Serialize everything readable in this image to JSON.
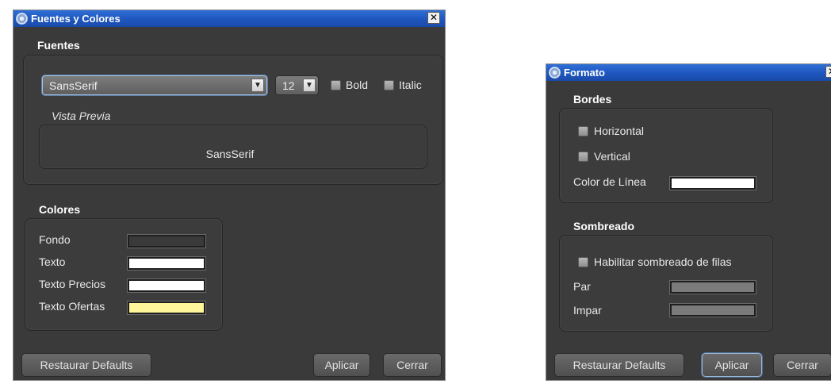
{
  "left_window": {
    "title": "Fuentes y Colores",
    "close_glyph": "✕",
    "fuentes": {
      "label": "Fuentes",
      "font_select": "SansSerif",
      "size_select": "12",
      "bold_label": "Bold",
      "italic_label": "Italic",
      "preview_label": "Vista Previa",
      "preview_text": "SansSerif"
    },
    "colores": {
      "label": "Colores",
      "rows": [
        {
          "label": "Fondo",
          "color": "#3a3a3a"
        },
        {
          "label": "Texto",
          "color": "#ffffff"
        },
        {
          "label": "Texto Precios",
          "color": "#ffffff"
        },
        {
          "label": "Texto Ofertas",
          "color": "#fff59a"
        }
      ]
    },
    "buttons": {
      "restore": "Restaurar Defaults",
      "apply": "Aplicar",
      "close": "Cerrar"
    }
  },
  "right_window": {
    "title": "Formato",
    "close_glyph": "✕",
    "bordes": {
      "label": "Bordes",
      "horizontal_label": "Horizontal",
      "vertical_label": "Vertical",
      "line_color_label": "Color de Línea",
      "line_color": "#ffffff"
    },
    "sombreado": {
      "label": "Sombreado",
      "enable_label": "Habilitar sombreado de filas",
      "par_label": "Par",
      "par_color": "#7b7b7b",
      "impar_label": "Impar",
      "impar_color": "#7b7b7b"
    },
    "buttons": {
      "restore": "Restaurar Defaults",
      "apply": "Aplicar",
      "close": "Cerrar"
    }
  }
}
